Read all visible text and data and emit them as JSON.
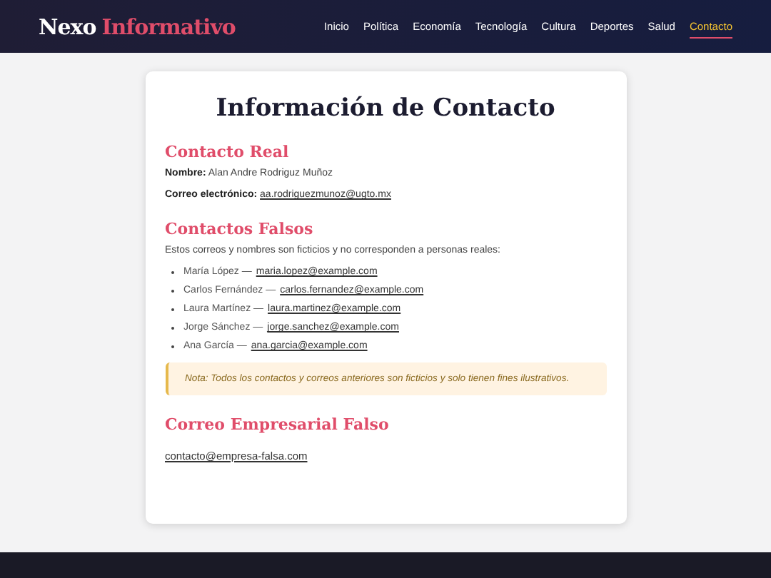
{
  "header": {
    "logo": {
      "first": "Nexo",
      "second": "Informativo"
    },
    "nav": [
      {
        "label": "Inicio",
        "selected": false
      },
      {
        "label": "Política",
        "selected": false
      },
      {
        "label": "Economía",
        "selected": false
      },
      {
        "label": "Tecnología",
        "selected": false
      },
      {
        "label": "Cultura",
        "selected": false
      },
      {
        "label": "Deportes",
        "selected": false
      },
      {
        "label": "Salud",
        "selected": false
      },
      {
        "label": "Contacto",
        "selected": true
      }
    ]
  },
  "card": {
    "title": "Información de Contacto",
    "real": {
      "heading": "Contacto Real",
      "name_label": "Nombre:",
      "name": "Alan Andre Rodriguz Muñoz",
      "email_label": "Correo electrónico:",
      "email": "aa.rodriguezmunoz@ugto.mx"
    },
    "fake": {
      "heading": "Contactos Falsos",
      "intro": "Estos correos y nombres son ficticios y no corresponden a personas reales:",
      "items": [
        {
          "name": "María López —",
          "email": "maria.lopez@example.com"
        },
        {
          "name": "Carlos Fernández —",
          "email": "carlos.fernandez@example.com"
        },
        {
          "name": "Laura Martínez —",
          "email": "laura.martinez@example.com"
        },
        {
          "name": "Jorge Sánchez —",
          "email": "jorge.sanchez@example.com"
        },
        {
          "name": "Ana García —",
          "email": "ana.garcia@example.com"
        }
      ],
      "note": "Nota: Todos los contactos y correos anteriores son ficticios y solo tienen fines ilustrativos."
    },
    "business": {
      "heading": "Correo Empresarial Falso",
      "email": "contacto@empresa-falsa.com"
    }
  }
}
